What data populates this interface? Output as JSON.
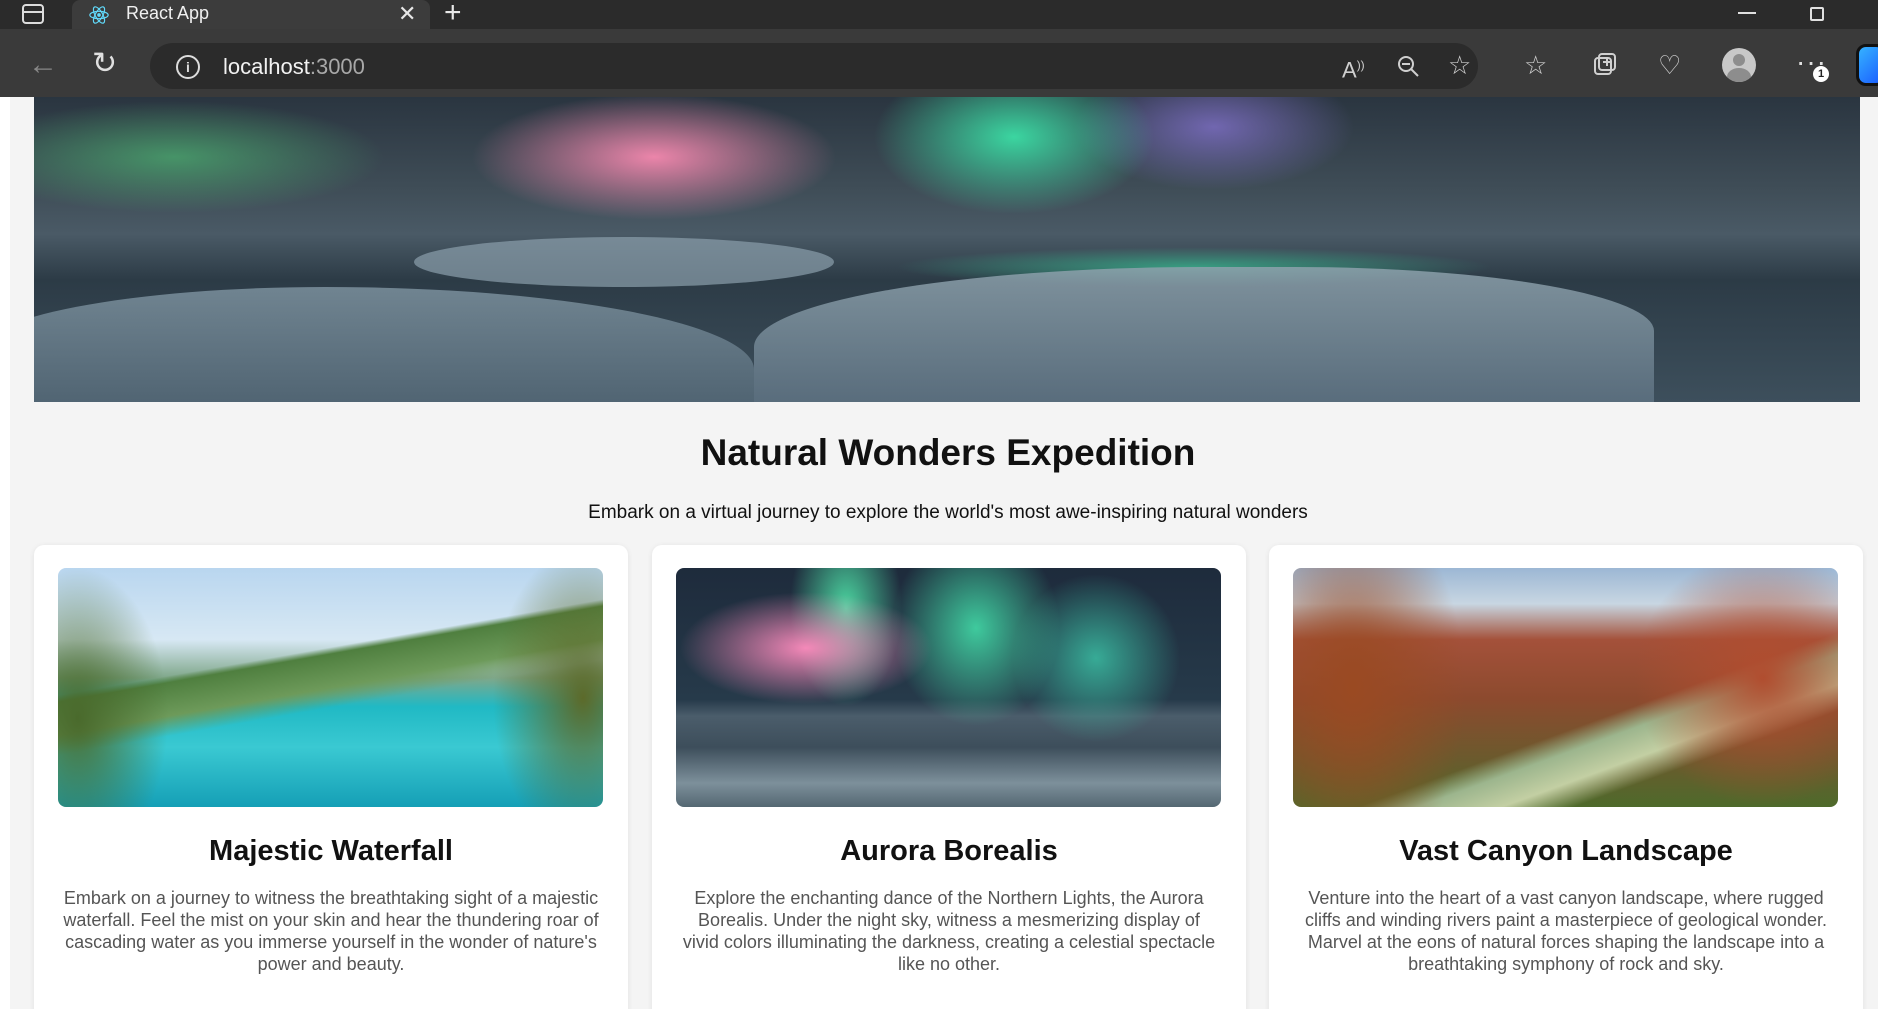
{
  "browser": {
    "tab_title": "React App",
    "tab_close_glyph": "✕",
    "new_tab_glyph": "+",
    "url_host": "localhost",
    "url_port": ":3000",
    "notification_count": "1",
    "icons": [
      "tab-actions-icon",
      "react-favicon-icon",
      "back-arrow-icon",
      "reload-icon",
      "info-icon",
      "read-aloud-icon",
      "zoom-out-icon",
      "add-favorite-icon",
      "favorites-icon",
      "collections-icon",
      "browser-essentials-icon",
      "profile-icon",
      "more-icon",
      "copilot-icon"
    ]
  },
  "page": {
    "title": "Natural Wonders Expedition",
    "subtitle": "Embark on a virtual journey to explore the world's most awe-inspiring natural wonders"
  },
  "cards": [
    {
      "title": "Majestic Waterfall",
      "text": "Embark on a journey to witness the breathtaking sight of a majestic waterfall. Feel the mist on your skin and hear the thundering roar of cascading water as you immerse yourself in the wonder of nature's power and beauty."
    },
    {
      "title": "Aurora Borealis",
      "text": "Explore the enchanting dance of the Northern Lights, the Aurora Borealis. Under the night sky, witness a mesmerizing display of vivid colors illuminating the darkness, creating a celestial spectacle like no other."
    },
    {
      "title": "Vast Canyon Landscape",
      "text": "Venture into the heart of a vast canyon landscape, where rugged cliffs and winding rivers paint a masterpiece of geological wonder. Marvel at the eons of natural forces shaping the landscape into a breathtaking symphony of rock and sky."
    }
  ],
  "colors": {
    "page_background": "#f4f4f4",
    "card_background": "#ffffff",
    "browser_frame": "#2b2b2b",
    "toolbar": "#3a3a3a"
  }
}
